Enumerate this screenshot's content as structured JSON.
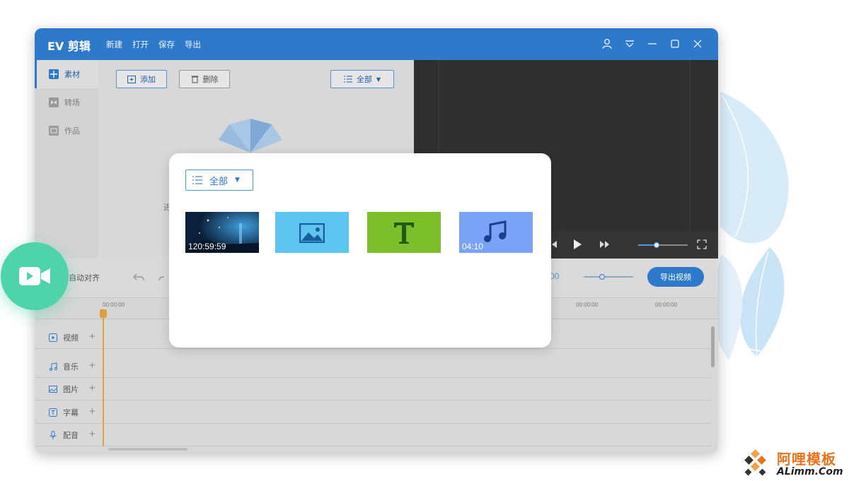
{
  "app": {
    "title": "EV 剪辑",
    "menu": [
      "新建",
      "打开",
      "保存",
      "导出"
    ],
    "window_controls": [
      "user-icon",
      "dropdown-menu-icon",
      "minimize-icon",
      "maximize-icon",
      "close-icon"
    ]
  },
  "sidebar": {
    "items": [
      {
        "label": "素材",
        "icon": "media-grid-icon",
        "active": true
      },
      {
        "label": "转场",
        "icon": "transition-icon",
        "active": false
      },
      {
        "label": "作品",
        "icon": "works-icon",
        "active": false
      }
    ]
  },
  "media_toolbar": {
    "add_label": "添加",
    "delete_label": "删除",
    "filter_label": "全部"
  },
  "media_pane": {
    "hint_partial": "进"
  },
  "edit_toolbar": {
    "auto_align_label": "自动对齐",
    "time_partial": "00",
    "export_label": "导出视频"
  },
  "ruler": {
    "labels": [
      "00:00:00",
      "00:00:00",
      "00:00:00"
    ]
  },
  "tracks": [
    {
      "label": "视频",
      "icon": "video-track-icon"
    },
    {
      "label": "音乐",
      "icon": "music-track-icon"
    },
    {
      "label": "图片",
      "icon": "image-track-icon"
    },
    {
      "label": "字幕",
      "icon": "subtitle-track-icon"
    },
    {
      "label": "配音",
      "icon": "microphone-icon"
    }
  ],
  "modal": {
    "filter_label": "全部",
    "tiles": [
      {
        "type": "video",
        "duration": "120:59:59",
        "color": "#0b2a4a"
      },
      {
        "type": "image",
        "color": "#5ec4f0"
      },
      {
        "type": "text",
        "glyph": "T",
        "color": "#7dbf2a"
      },
      {
        "type": "music",
        "duration": "04:10",
        "color": "#7aa3f7"
      }
    ]
  },
  "watermark": {
    "title": "阿哩模板",
    "subtitle": "ALimm.Com"
  },
  "colors": {
    "brand_blue": "#2e79c9",
    "accent_green": "#4fd3a8",
    "playhead": "#d9a23e"
  }
}
